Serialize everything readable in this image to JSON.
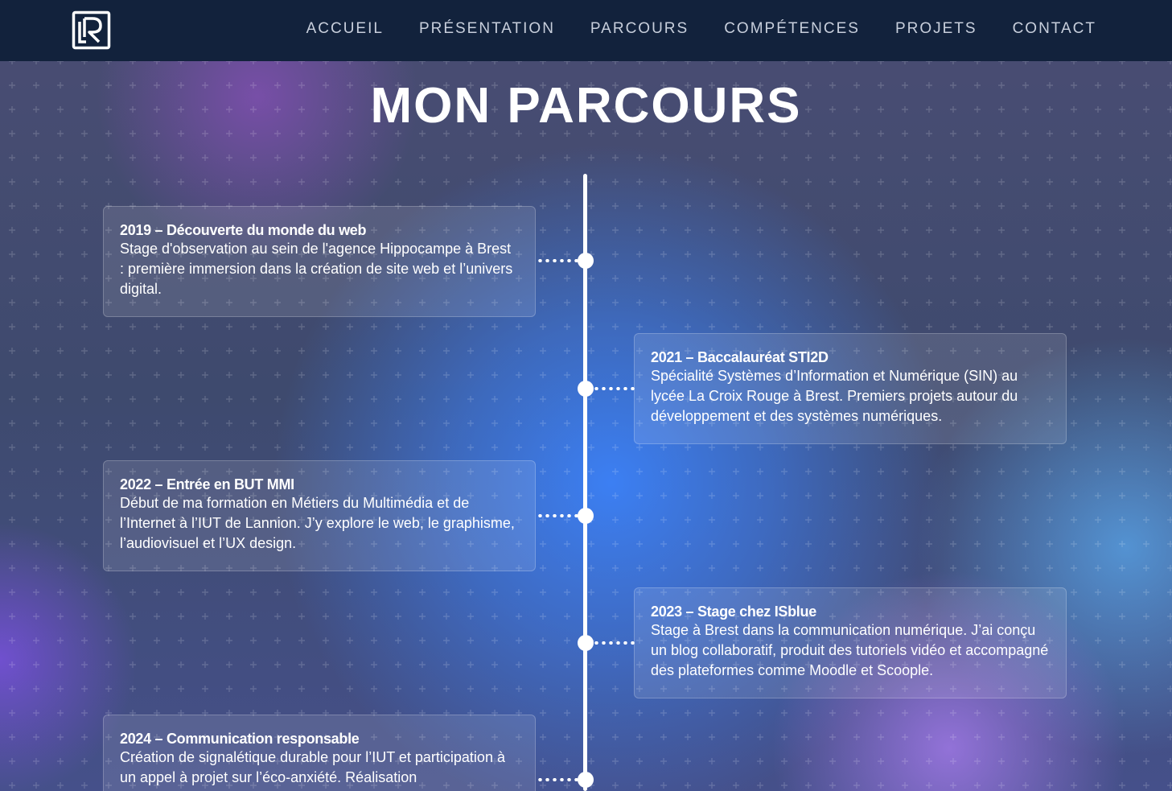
{
  "nav": {
    "logo_name": "logo-icon",
    "items": [
      {
        "label": "ACCUEIL"
      },
      {
        "label": "PRÉSENTATION"
      },
      {
        "label": "PARCOURS"
      },
      {
        "label": "COMPÉTENCES"
      },
      {
        "label": "PROJETS"
      },
      {
        "label": "CONTACT"
      }
    ]
  },
  "title": "MON PARCOURS",
  "timeline": [
    {
      "title": "2019 – Découverte du monde du web",
      "text": "Stage d'observation au sein de l'agence Hippocampe à Brest : première immersion dans la création de site web et l’univers digital."
    },
    {
      "title": "2021 – Baccalauréat STI2D",
      "text": "Spécialité Systèmes d’Information et Numérique (SIN) au lycée La Croix Rouge à Brest. Premiers projets autour du développement et des systèmes numériques."
    },
    {
      "title": "2022 – Entrée en BUT MMI",
      "text": "Début de ma formation en Métiers du Multimédia et de l’Internet à l’IUT de Lannion. J’y explore le web, le graphisme, l’audiovisuel et l’UX design."
    },
    {
      "title": "2023 – Stage chez ISblue",
      "text": "Stage à Brest dans la communication numérique. J’ai conçu un blog collaboratif, produit des tutoriels vidéo et accompagné des plateformes comme Moodle et Scoople."
    },
    {
      "title": "2024 – Communication responsable",
      "text": "Création de signalétique durable pour l’IUT et participation à un appel à projet sur l’éco-anxiété. Réalisation"
    }
  ],
  "colors": {
    "navbar": "#12223c",
    "nav_text": "#c8cfdc",
    "accent": "#ffffff"
  }
}
